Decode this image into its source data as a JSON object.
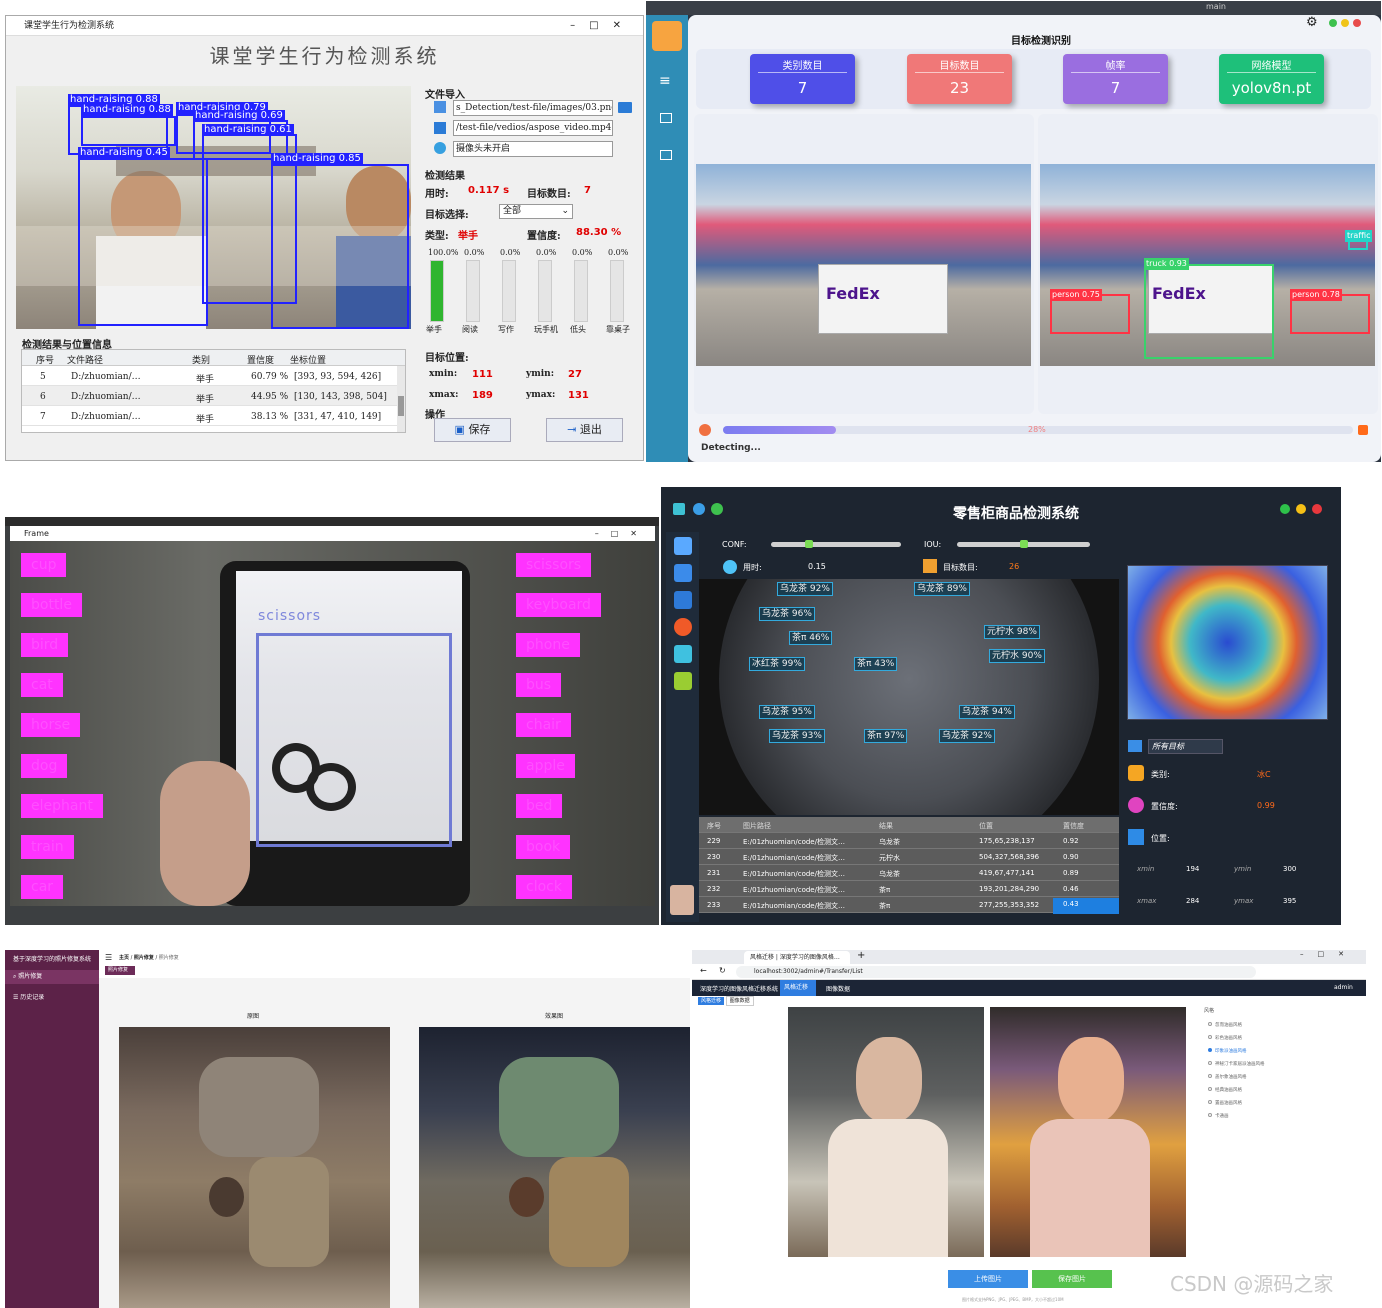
{
  "panel1": {
    "window_title": "课堂学生行为检测系统",
    "app_title": "课堂学生行为检测系统",
    "detections": [
      {
        "label": "hand-raising  0.88"
      },
      {
        "label": "hand-raising  0.88"
      },
      {
        "label": "hand-raising  0.79"
      },
      {
        "label": "hand-raising  0.69"
      },
      {
        "label": "hand-raising  0.61"
      },
      {
        "label": "hand-raising  0.45"
      },
      {
        "label": "hand-raising  0.85"
      }
    ],
    "file_import_label": "文件导入",
    "image_path": "s_Detection/test-file/images/03.png",
    "video_path": "/test-file/vedios/aspose_video.mp4",
    "camera_status": "摄像头未开启",
    "results_label": "检测结果",
    "time_label": "用时:",
    "time_value": "0.117 s",
    "count_label": "目标数目:",
    "count_value": "7",
    "target_select_label": "目标选择:",
    "target_select_value": "全部",
    "type_label": "类型:",
    "type_value": "举手",
    "confidence_label": "置信度:",
    "confidence_value": "88.30 %",
    "class_bars": [
      {
        "pct_text": "100.0%",
        "name": "举手",
        "value": 1.0
      },
      {
        "pct_text": "0.0%",
        "name": "阅读",
        "value": 0
      },
      {
        "pct_text": "0.0%",
        "name": "写作",
        "value": 0
      },
      {
        "pct_text": "0.0%",
        "name": "玩手机",
        "value": 0
      },
      {
        "pct_text": "0.0%",
        "name": "低头",
        "value": 0
      },
      {
        "pct_text": "0.0%",
        "name": "靠桌子",
        "value": 0
      }
    ],
    "position_label": "目标位置:",
    "xmin_label": "xmin:",
    "xmin_value": "111",
    "ymin_label": "ymin:",
    "ymin_value": "27",
    "xmax_label": "xmax:",
    "xmax_value": "189",
    "ymax_label": "ymax:",
    "ymax_value": "131",
    "ops_label": "操作",
    "save_label": "保存",
    "exit_label": "退出",
    "table_title": "检测结果与位置信息",
    "table_headers": [
      "序号",
      "文件路径",
      "类别",
      "置信度",
      "坐标位置"
    ],
    "table_rows": [
      [
        "5",
        "D:/zhuomian/…",
        "举手",
        "60.79 %",
        "[393, 93, 594, 426]"
      ],
      [
        "6",
        "D:/zhuomian/…",
        "举手",
        "44.95 %",
        "[130, 143, 398, 504]"
      ],
      [
        "7",
        "D:/zhuomian/…",
        "举手",
        "38.13 %",
        "[331, 47, 410, 149]"
      ]
    ]
  },
  "panel2": {
    "title": "目标检测识别",
    "cards": [
      {
        "title": "类别数目",
        "value": "7",
        "color": "#4f4fe8"
      },
      {
        "title": "目标数目",
        "value": "23",
        "color": "#f07878"
      },
      {
        "title": "帧率",
        "value": "7",
        "color": "#9a6ee0"
      },
      {
        "title": "网络模型",
        "value": "yolov8n.pt",
        "color": "#1ec07a"
      }
    ],
    "progress_text": "28%",
    "progress": 0.28,
    "status": "Detecting...",
    "git_branch": "main",
    "detections": [
      {
        "label": "truck  0.93"
      },
      {
        "label": "person 0.75"
      },
      {
        "label": "person 0.78"
      },
      {
        "label": "traffic"
      }
    ]
  },
  "panel3": {
    "window_title": "Frame",
    "left_labels": [
      "cup",
      "bottle",
      "bird",
      "cat",
      "horse",
      "dog",
      "elephant",
      "train",
      "car"
    ],
    "right_labels": [
      "scissors",
      "keyboard",
      "phone",
      "bus",
      "chair",
      "apple",
      "bed",
      "book",
      "clock"
    ],
    "detection_label": "scissors"
  },
  "panel4": {
    "title": "零售柜商品检测系统",
    "conf_label": "CONF:",
    "iou_label": "IOU:",
    "time_label": "用时:",
    "time_value": "0.15",
    "count_label": "目标数目:",
    "count_value": "26",
    "conf_value": 0.28,
    "iou_value": 0.5,
    "all_targets": "所有目标",
    "category_label": "类别:",
    "category_value": "冰C",
    "confidence_label": "置信度:",
    "confidence_value": "0.99",
    "position_label": "位置:",
    "xmin_label": "xmin",
    "xmin_value": "194",
    "ymin_label": "ymin",
    "ymin_value": "300",
    "xmax_label": "xmax",
    "xmax_value": "284",
    "ymax_label": "ymax",
    "ymax_value": "395",
    "table_headers": [
      "序号",
      "图片路径",
      "结果",
      "位置",
      "置信度"
    ],
    "table_rows": [
      [
        "229",
        "E:/01zhuomian/code/检测文…",
        "乌龙茶",
        "175,65,238,137",
        "0.92"
      ],
      [
        "230",
        "E:/01zhuomian/code/检测文…",
        "元柠水",
        "504,327,568,396",
        "0.90"
      ],
      [
        "231",
        "E:/01zhuomian/code/检测文…",
        "乌龙茶",
        "419,67,477,141",
        "0.89"
      ],
      [
        "232",
        "E:/01zhuomian/code/检测文…",
        "茶π",
        "193,201,284,290",
        "0.46"
      ],
      [
        "233",
        "E:/01zhuomian/code/检测文…",
        "茶π",
        "277,255,353,352",
        "0.43"
      ]
    ],
    "product_labels": [
      "乌龙茶 92%",
      "乌龙茶 89%",
      "乌龙茶 96%",
      "茶π 46%",
      "茶π 43%",
      "冰红茶 99%",
      "元柠水 98%",
      "元柠水 90%",
      "乌龙茶 95%",
      "乌龙茶 93%",
      "茶π 97%",
      "乌龙茶 92%",
      "乌龙茶 94%"
    ]
  },
  "panel5": {
    "app_name": "基于深度学习的照片修复系统",
    "nav": [
      "照片修复",
      "历史记录"
    ],
    "breadcrumb": [
      "主页",
      "照片修复",
      "照片修复"
    ],
    "tag": "照片修复",
    "original_label": "原图",
    "result_label": "效果图"
  },
  "panel6": {
    "tab_title": "风格迁移 | 深度学习的图像风格…",
    "url": "localhost:3002/admin#/Transfer/List",
    "app_name": "深度学习的图像风格迁移系统",
    "nav": [
      "风格迁移",
      "图像数据"
    ],
    "user": "admin",
    "tags": [
      "风格迁移",
      "图像数据"
    ],
    "styles_title": "风格",
    "styles": [
      "忽而油画风格",
      "彩色油画风格",
      "印象派油画风格",
      "神秘汀卡家居派油画风格",
      "盖尔象油画风格",
      "经典油画风格",
      "置画油画风格",
      "卡通画"
    ],
    "upload_label": "上传图片",
    "save_label": "保存图片",
    "hint": "图片格式支持PNG、JPG、JPEG、BMP，大小不超过10M",
    "watermark": "CSDN @源码之家"
  }
}
